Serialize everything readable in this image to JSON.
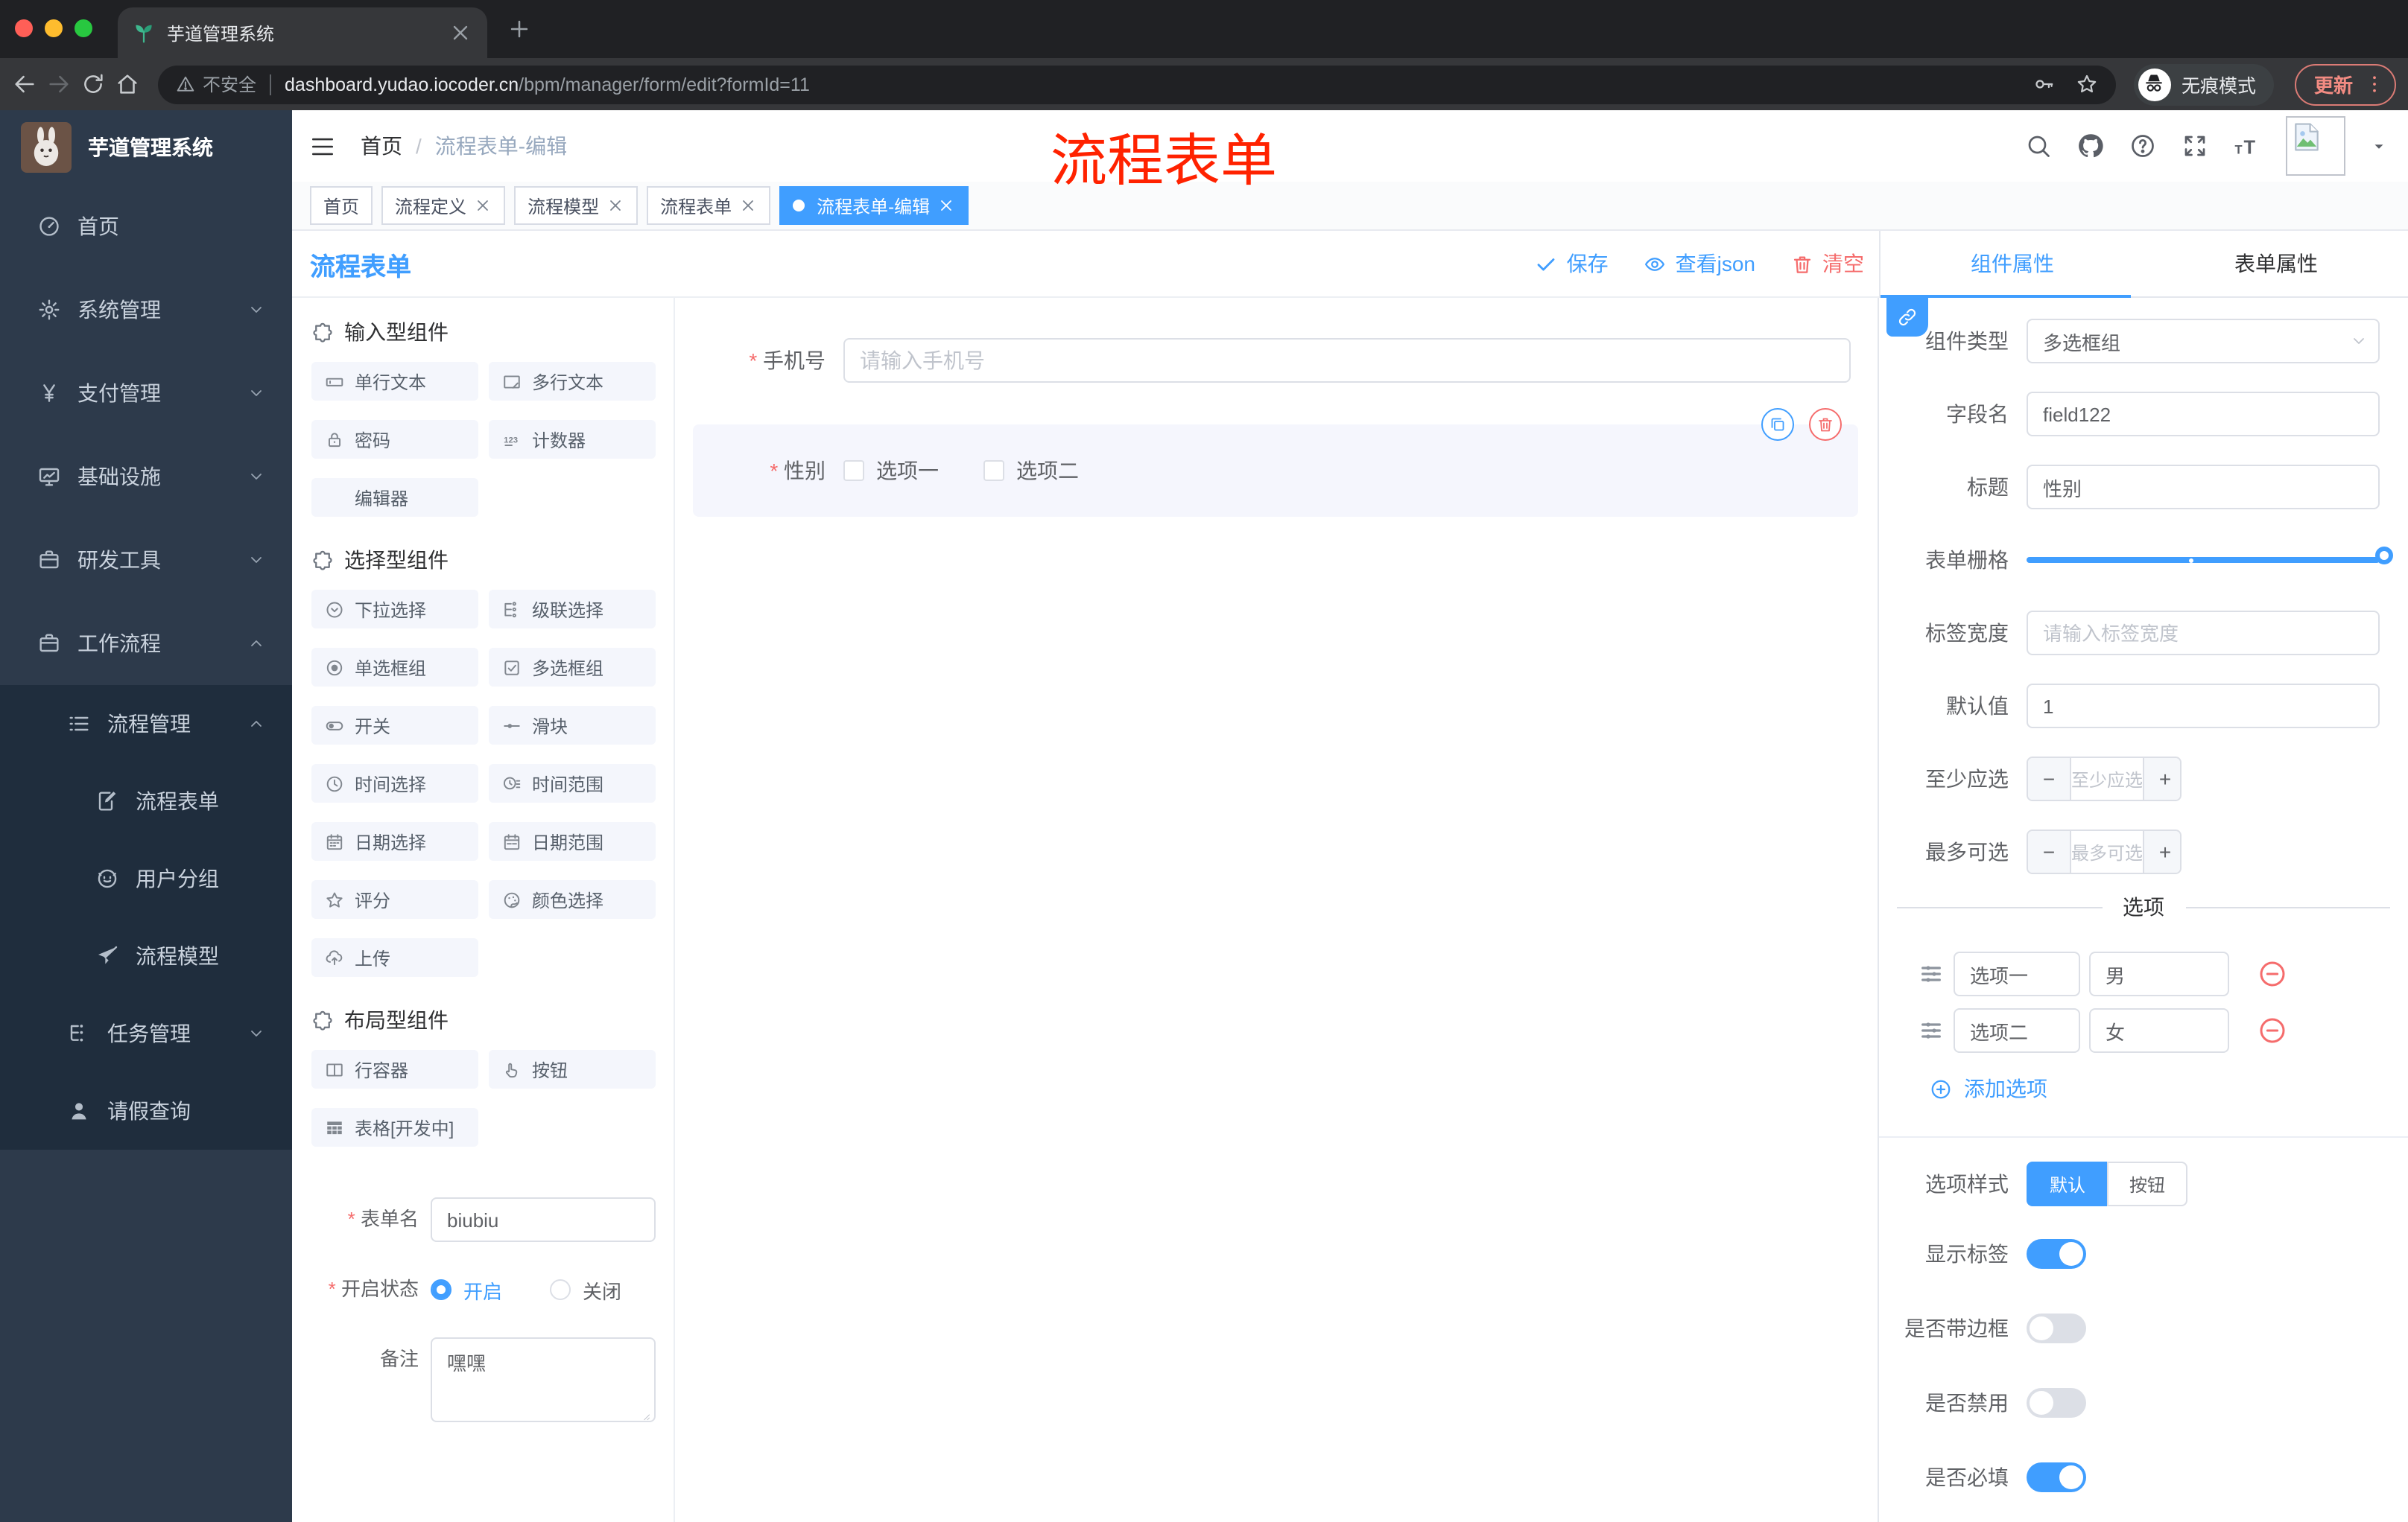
{
  "browser": {
    "tab_title": "芋道管理系统",
    "security_label": "不安全",
    "url_host": "dashboard.yudao.iocoder.cn",
    "url_path": "/bpm/manager/form/edit?formId=11",
    "incognito_label": "无痕模式",
    "update_button": "更新"
  },
  "sidebar": {
    "app_title": "芋道管理系统",
    "items": [
      {
        "label": "首页",
        "icon": "dashboard-icon",
        "chevron": ""
      },
      {
        "label": "系统管理",
        "icon": "gear-icon",
        "chevron": "down"
      },
      {
        "label": "支付管理",
        "icon": "yen-icon",
        "chevron": "down"
      },
      {
        "label": "基础设施",
        "icon": "monitor-icon",
        "chevron": "down"
      },
      {
        "label": "研发工具",
        "icon": "briefcase-icon",
        "chevron": "down"
      },
      {
        "label": "工作流程",
        "icon": "workflow-icon",
        "chevron": "up"
      }
    ],
    "submenu": [
      {
        "label": "流程管理",
        "icon": "list-tree-icon",
        "chevron": "up"
      },
      {
        "label": "流程表单",
        "icon": "form-edit-icon"
      },
      {
        "label": "用户分组",
        "icon": "user-group-icon"
      },
      {
        "label": "流程模型",
        "icon": "paper-plane-icon"
      },
      {
        "label": "任务管理",
        "icon": "task-tree-icon",
        "chevron": "down"
      },
      {
        "label": "请假查询",
        "icon": "person-icon"
      }
    ]
  },
  "header": {
    "breadcrumb_home": "首页",
    "breadcrumb_current": "流程表单-编辑",
    "watermark": "流程表单"
  },
  "tags": [
    {
      "label": "首页"
    },
    {
      "label": "流程定义"
    },
    {
      "label": "流程模型"
    },
    {
      "label": "流程表单"
    },
    {
      "label": "流程表单-编辑"
    }
  ],
  "designer": {
    "title": "流程表单",
    "toolbar": {
      "save": "保存",
      "view_json": "查看json",
      "clear": "清空"
    },
    "palette": {
      "sections": [
        {
          "title": "输入型组件",
          "items": [
            {
              "label": "单行文本",
              "icon": "input-icon"
            },
            {
              "label": "多行文本",
              "icon": "textarea-icon"
            },
            {
              "label": "密码",
              "icon": "lock-icon"
            },
            {
              "label": "计数器",
              "icon": "counter-icon"
            },
            {
              "label": "编辑器",
              "icon": ""
            }
          ]
        },
        {
          "title": "选择型组件",
          "items": [
            {
              "label": "下拉选择",
              "icon": "dropdown-icon"
            },
            {
              "label": "级联选择",
              "icon": "cascade-icon"
            },
            {
              "label": "单选框组",
              "icon": "radio-icon"
            },
            {
              "label": "多选框组",
              "icon": "checkbox-icon"
            },
            {
              "label": "开关",
              "icon": "switch-icon"
            },
            {
              "label": "滑块",
              "icon": "slider-icon"
            },
            {
              "label": "时间选择",
              "icon": "time-icon"
            },
            {
              "label": "时间范围",
              "icon": "time-range-icon"
            },
            {
              "label": "日期选择",
              "icon": "date-icon"
            },
            {
              "label": "日期范围",
              "icon": "date-range-icon"
            },
            {
              "label": "评分",
              "icon": "rate-icon"
            },
            {
              "label": "颜色选择",
              "icon": "color-icon"
            },
            {
              "label": "上传",
              "icon": "upload-icon"
            }
          ]
        },
        {
          "title": "布局型组件",
          "items": [
            {
              "label": "行容器",
              "icon": "row-container-icon"
            },
            {
              "label": "按钮",
              "icon": "button-icon"
            },
            {
              "label": "表格[开发中]",
              "icon": "table-icon"
            }
          ]
        }
      ]
    },
    "meta_form": {
      "name_label": "表单名",
      "name_value": "biubiu",
      "status_label": "开启状态",
      "status_on": "开启",
      "status_off": "关闭",
      "remark_label": "备注",
      "remark_value": "嘿嘿"
    },
    "canvas": {
      "phone_label": "手机号",
      "phone_placeholder": "请输入手机号",
      "gender_label": "性别",
      "gender_option1": "选项一",
      "gender_option2": "选项二"
    },
    "props": {
      "tab_component": "组件属性",
      "tab_form": "表单属性",
      "component_type_label": "组件类型",
      "component_type_value": "多选框组",
      "field_name_label": "字段名",
      "field_name_value": "field122",
      "title_label": "标题",
      "title_value": "性别",
      "grid_label": "表单栅格",
      "label_width_label": "标签宽度",
      "label_width_placeholder": "请输入标签宽度",
      "default_label": "默认值",
      "default_value": "1",
      "min_label": "至少应选",
      "min_placeholder": "至少应选",
      "max_label": "最多可选",
      "max_placeholder": "最多可选",
      "options_title": "选项",
      "option_rows": [
        {
          "label": "选项一",
          "value": "男"
        },
        {
          "label": "选项二",
          "value": "女"
        }
      ],
      "add_option": "添加选项",
      "option_style_label": "选项样式",
      "style_default": "默认",
      "style_button": "按钮",
      "show_label_label": "显示标签",
      "border_label": "是否带边框",
      "disabled_label": "是否禁用",
      "required_label": "是否必填"
    }
  },
  "colors": {
    "primary": "#409eff",
    "danger": "#f56c6c",
    "watermark": "#ff2200",
    "sidebar": "#2d3a4b",
    "submenu": "#1f2d3d"
  }
}
